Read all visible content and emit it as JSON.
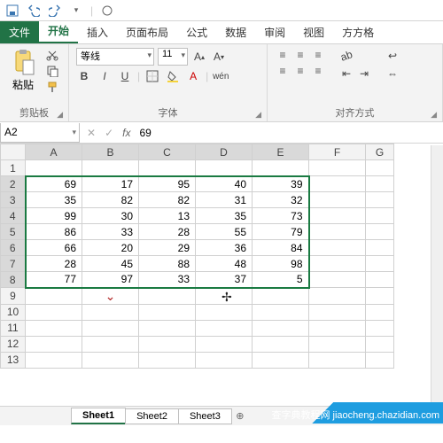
{
  "qat": {
    "save": "save-icon",
    "undo": "undo-icon",
    "redo": "redo-icon"
  },
  "tabs": [
    "文件",
    "开始",
    "插入",
    "页面布局",
    "公式",
    "数据",
    "审阅",
    "视图",
    "方方格"
  ],
  "active_tab": "开始",
  "ribbon": {
    "clipboard": {
      "paste": "粘贴",
      "label": "剪贴板"
    },
    "font": {
      "name": "等线",
      "size": "11",
      "label": "字体",
      "wen": "wén"
    },
    "align": {
      "label": "对齐方式"
    }
  },
  "namebox": "A2",
  "formula": "69",
  "cols": [
    "A",
    "B",
    "C",
    "D",
    "E",
    "F",
    "G"
  ],
  "rows": [
    1,
    2,
    3,
    4,
    5,
    6,
    7,
    8,
    9,
    10,
    11,
    12,
    13
  ],
  "chart_data": {
    "type": "table",
    "title": "",
    "columns": [
      "A",
      "B",
      "C",
      "D",
      "E"
    ],
    "row_start": 2,
    "values": [
      [
        69,
        17,
        95,
        40,
        39
      ],
      [
        35,
        82,
        82,
        31,
        32
      ],
      [
        99,
        30,
        13,
        35,
        73
      ],
      [
        86,
        33,
        28,
        55,
        79
      ],
      [
        66,
        20,
        29,
        36,
        84
      ],
      [
        28,
        45,
        88,
        48,
        98
      ],
      [
        77,
        97,
        33,
        37,
        5
      ]
    ]
  },
  "sheets": [
    "Sheet1",
    "Sheet2",
    "Sheet3"
  ],
  "active_sheet": "Sheet1",
  "watermark": "查字典教程网\njiaocheng.chazidian.com"
}
